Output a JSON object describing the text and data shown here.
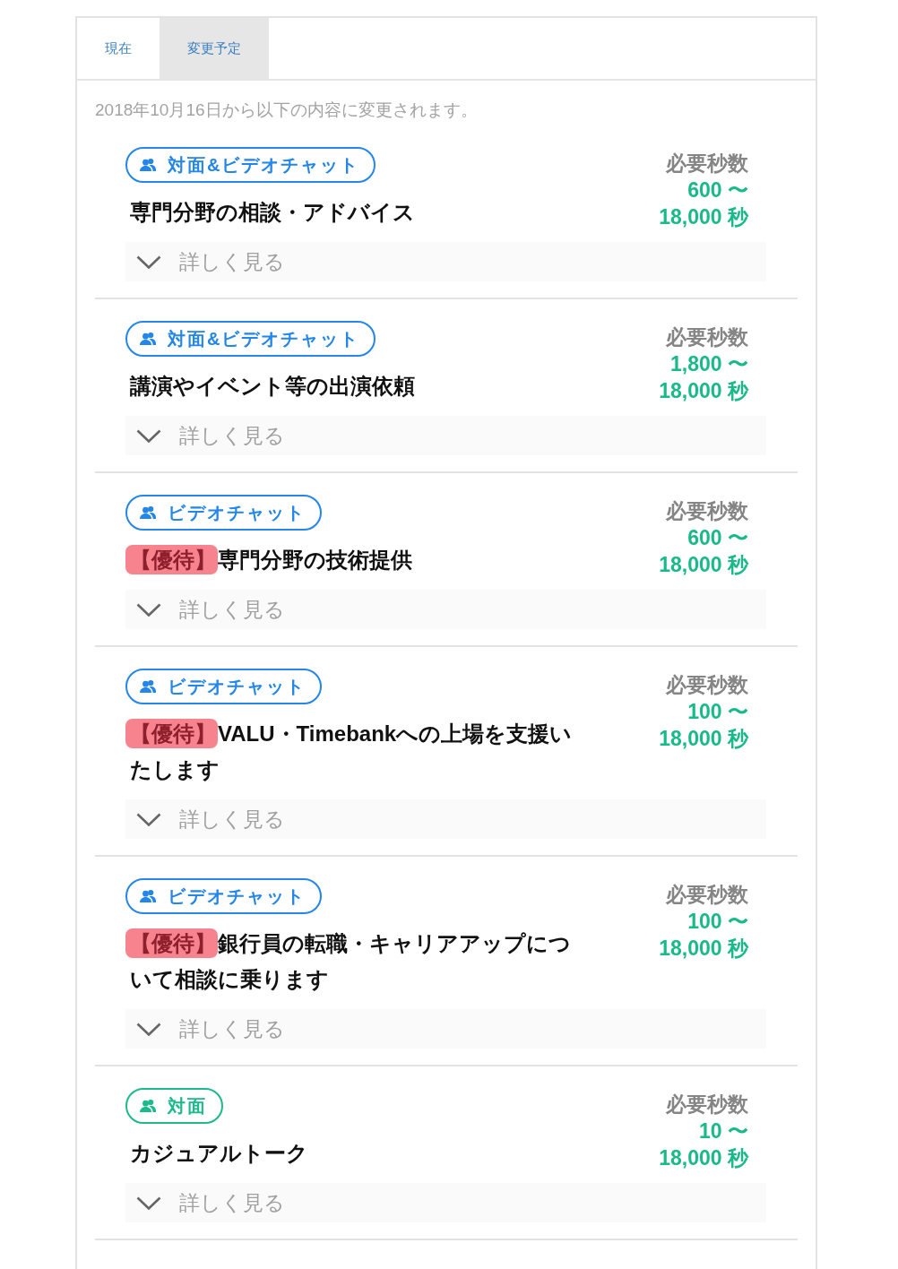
{
  "tabs": [
    {
      "label": "現在",
      "selected": false
    },
    {
      "label": "変更予定",
      "selected": true
    }
  ],
  "notice": "2018年10月16日から以下の内容に変更されます。",
  "services": [
    {
      "tag": {
        "label": "対面&ビデオチャット",
        "color": "#2386e8"
      },
      "title": "専門分野の相談・アドバイス",
      "time_label": "必要秒数",
      "time_from": "600 〜",
      "time_to": "18,000 秒",
      "more": "詳しく見る"
    },
    {
      "tag": {
        "label": "対面&ビデオチャット",
        "color": "#2386e8"
      },
      "title": "講演やイベント等の出演依頼",
      "time_label": "必要秒数",
      "time_from": "1,800 〜",
      "time_to": "18,000 秒",
      "more": "詳しく見る"
    },
    {
      "tag": {
        "label": "ビデオチャット",
        "color": "#2386e8"
      },
      "prefix": "【優待】",
      "prefix_highlighted": true,
      "title": "専門分野の技術提供",
      "time_label": "必要秒数",
      "time_from": "600 〜",
      "time_to": "18,000 秒",
      "more": "詳しく見る"
    },
    {
      "tag": {
        "label": "ビデオチャット",
        "color": "#2386e8"
      },
      "prefix": "【優待】",
      "prefix_highlighted": true,
      "title": "VALU・Timebankへの上場を支援いたします",
      "time_label": "必要秒数",
      "time_from": "100 〜",
      "time_to": "18,000 秒",
      "more": "詳しく見る"
    },
    {
      "tag": {
        "label": "ビデオチャット",
        "color": "#2386e8"
      },
      "prefix": "【優待】",
      "prefix_highlighted": true,
      "title": "銀行員の転職・キャリアアップについて相談に乗ります",
      "time_label": "必要秒数",
      "time_from": "100 〜",
      "time_to": "18,000 秒",
      "more": "詳しく見る"
    },
    {
      "tag": {
        "label": "対面",
        "color": "#1bb98b"
      },
      "title": "カジュアルトーク",
      "time_label": "必要秒数",
      "time_from": "10 〜",
      "time_to": "18,000 秒",
      "more": "詳しく見る"
    }
  ]
}
